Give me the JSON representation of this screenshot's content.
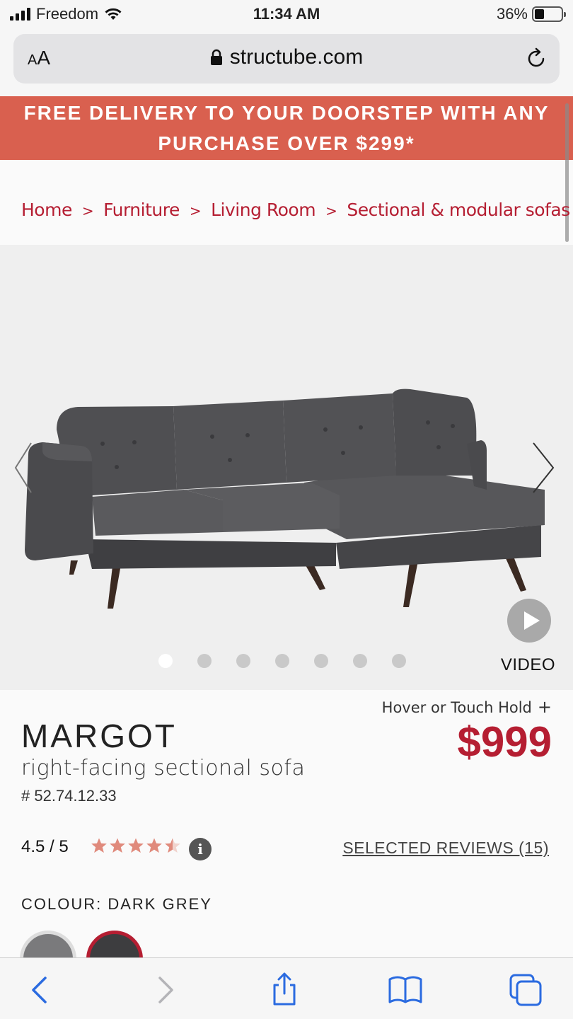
{
  "status_bar": {
    "carrier": "Freedom",
    "time": "11:34 AM",
    "battery": "36%",
    "battery_level": 0.36
  },
  "browser": {
    "aa_label_small": "A",
    "aa_label_large": "A",
    "url": "structube.com",
    "icons": [
      "lock-icon",
      "reload-icon"
    ]
  },
  "promo": {
    "line1": "FREE DELIVERY TO YOUR DOORSTEP WITH ANY",
    "line2": "PURCHASE OVER $299*"
  },
  "breadcrumb": {
    "items": [
      "Home",
      "Furniture",
      "Living Room",
      "Sectional & modular sofas",
      "..."
    ],
    "separator": ">"
  },
  "gallery": {
    "video_label": "VIDEO",
    "dot_count": 7,
    "active_dot": 0
  },
  "product": {
    "hover_hint": "Hover or Touch Hold",
    "hover_plus": "+",
    "name": "MARGOT",
    "subtitle": "right-facing sectional sofa",
    "sku": "# 52.74.12.33",
    "price": "$999"
  },
  "rating": {
    "score": "4.5 / 5",
    "value": 4.5,
    "max": 5,
    "info": "i",
    "reviews_link": "SELECTED REVIEWS (15)"
  },
  "colour": {
    "label": "COLOUR: DARK GREY",
    "swatches": [
      "#7a7a7c",
      "#3d3d3f"
    ],
    "selected_index": 1
  },
  "colors": {
    "accent": "#b51e32",
    "promo_bg": "#d9604f",
    "star": "#e08a7c"
  }
}
